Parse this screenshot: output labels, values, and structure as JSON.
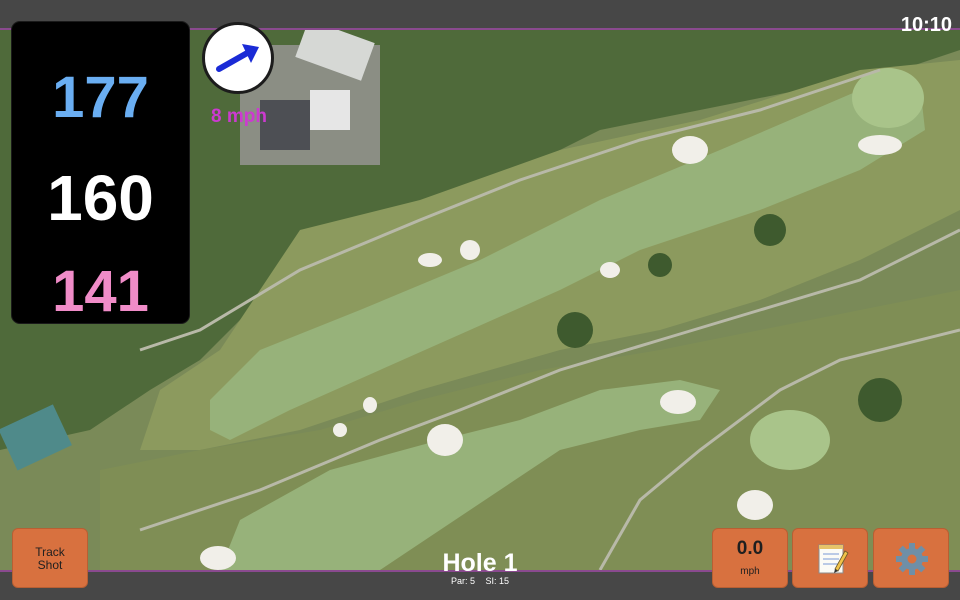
{
  "status_bar": {
    "time": "10:10"
  },
  "distances": {
    "back": "177",
    "middle": "160",
    "front": "141"
  },
  "wind": {
    "speed_label": "8 mph",
    "icon": "wind-arrow-icon"
  },
  "buttons": {
    "track_shot_line1": "Track",
    "track_shot_line2": "Shot",
    "speed_value": "0.0",
    "speed_unit": "mph",
    "notes_icon": "notepad-icon",
    "settings_icon": "gear-icon"
  },
  "hole": {
    "title": "Hole 1",
    "par": "Par: 5",
    "si": "SI: 15"
  },
  "colors": {
    "accent": "#d8713f",
    "back": "#6aaef2",
    "front": "#f08cc8",
    "wind": "#cc3ad0",
    "divider": "#8a4a8f"
  }
}
